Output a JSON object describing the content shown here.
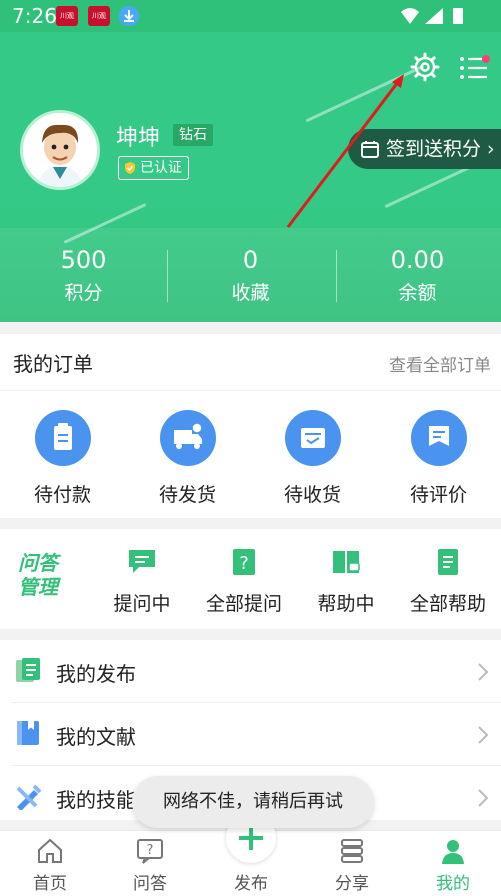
{
  "status_bar": {
    "time": "7:26",
    "badge1": "川观",
    "badge2": "川观"
  },
  "profile": {
    "name": "坤坤",
    "level": "钻石",
    "verified": "已认证",
    "checkin_label": "签到送积分"
  },
  "stats": [
    {
      "value": "500",
      "label": "积分"
    },
    {
      "value": "0",
      "label": "收藏"
    },
    {
      "value": "0.00",
      "label": "余额"
    }
  ],
  "orders": {
    "title": "我的订单",
    "view_all": "查看全部订单",
    "items": [
      {
        "label": "待付款",
        "icon": "clipboard-icon"
      },
      {
        "label": "待发货",
        "icon": "truck-icon"
      },
      {
        "label": "待收货",
        "icon": "inbox-icon"
      },
      {
        "label": "待评价",
        "icon": "comment-icon"
      }
    ]
  },
  "qa": {
    "logo_line1": "问答",
    "logo_line2": "管理",
    "items": [
      {
        "label": "提问中",
        "icon": "chat-icon"
      },
      {
        "label": "全部提问",
        "icon": "question-icon"
      },
      {
        "label": "帮助中",
        "icon": "book-chat-icon"
      },
      {
        "label": "全部帮助",
        "icon": "notebook-icon"
      }
    ]
  },
  "list": [
    {
      "label": "我的发布",
      "icon": "document-icon"
    },
    {
      "label": "我的文献",
      "icon": "bookmark-book-icon"
    },
    {
      "label": "我的技能",
      "icon": "tools-icon"
    }
  ],
  "toast": "网络不佳，请稍后再试",
  "bottom_nav": [
    {
      "label": "首页",
      "icon": "home-icon"
    },
    {
      "label": "问答",
      "icon": "question-chat-icon"
    },
    {
      "label": "发布",
      "icon": "plus-icon"
    },
    {
      "label": "分享",
      "icon": "share-stack-icon"
    },
    {
      "label": "我的",
      "icon": "person-icon"
    }
  ],
  "colors": {
    "primary": "#34c986",
    "accent_blue": "#4a94ef",
    "arrow_red": "#e11b1b"
  }
}
